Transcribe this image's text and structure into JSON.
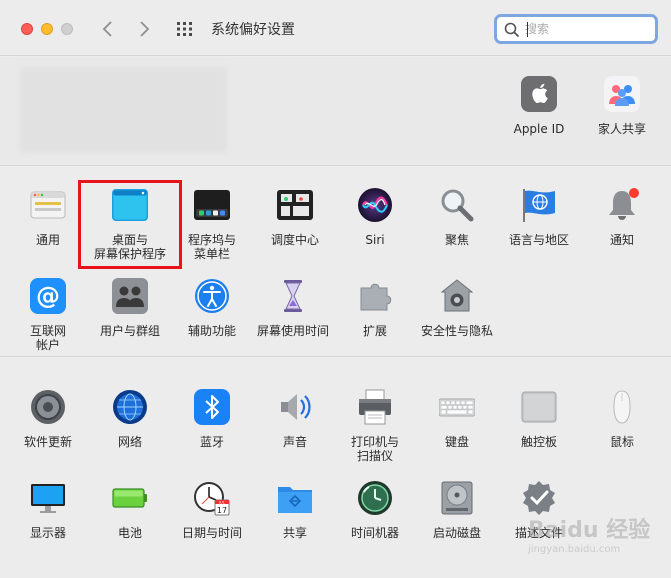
{
  "window": {
    "title": "系统偏好设置"
  },
  "search": {
    "placeholder": "搜索",
    "value": ""
  },
  "account": {
    "items": [
      {
        "label": "Apple ID",
        "icon": "apple-icon"
      },
      {
        "label": "家人共享",
        "icon": "family-icon"
      }
    ]
  },
  "section1": {
    "panes": [
      {
        "label": "通用",
        "icon": "general-icon"
      },
      {
        "label": "桌面与\n屏幕保护程序",
        "icon": "desktop-icon"
      },
      {
        "label": "程序坞与\n菜单栏",
        "icon": "dock-icon"
      },
      {
        "label": "调度中心",
        "icon": "mission-control-icon"
      },
      {
        "label": "Siri",
        "icon": "siri-icon"
      },
      {
        "label": "聚焦",
        "icon": "spotlight-icon"
      },
      {
        "label": "语言与地区",
        "icon": "language-icon"
      },
      {
        "label": "通知",
        "icon": "notifications-icon"
      },
      {
        "label": "互联网\n帐户",
        "icon": "internet-accounts-icon"
      },
      {
        "label": "用户与群组",
        "icon": "users-icon"
      },
      {
        "label": "辅助功能",
        "icon": "accessibility-icon"
      },
      {
        "label": "屏幕使用时间",
        "icon": "screen-time-icon"
      },
      {
        "label": "扩展",
        "icon": "extensions-icon"
      },
      {
        "label": "安全性与隐私",
        "icon": "security-icon"
      }
    ]
  },
  "section2": {
    "panes": [
      {
        "label": "软件更新",
        "icon": "software-update-icon"
      },
      {
        "label": "网络",
        "icon": "network-icon"
      },
      {
        "label": "蓝牙",
        "icon": "bluetooth-icon"
      },
      {
        "label": "声音",
        "icon": "sound-icon"
      },
      {
        "label": "打印机与\n扫描仪",
        "icon": "printer-icon"
      },
      {
        "label": "键盘",
        "icon": "keyboard-icon"
      },
      {
        "label": "触控板",
        "icon": "trackpad-icon"
      },
      {
        "label": "鼠标",
        "icon": "mouse-icon"
      },
      {
        "label": "显示器",
        "icon": "display-icon"
      },
      {
        "label": "电池",
        "icon": "battery-icon"
      },
      {
        "label": "日期与时间",
        "icon": "date-time-icon"
      },
      {
        "label": "共享",
        "icon": "sharing-icon"
      },
      {
        "label": "时间机器",
        "icon": "time-machine-icon"
      },
      {
        "label": "启动磁盘",
        "icon": "startup-disk-icon"
      },
      {
        "label": "描述文件",
        "icon": "profiles-icon"
      }
    ]
  },
  "calendar": {
    "month": "JUL",
    "day": "17"
  },
  "watermark": {
    "text": "Baidu 经验",
    "url": "jingyan.baidu.com"
  },
  "colors": {
    "highlight": "#e8141b",
    "search_focus": "#7ea6e0"
  }
}
